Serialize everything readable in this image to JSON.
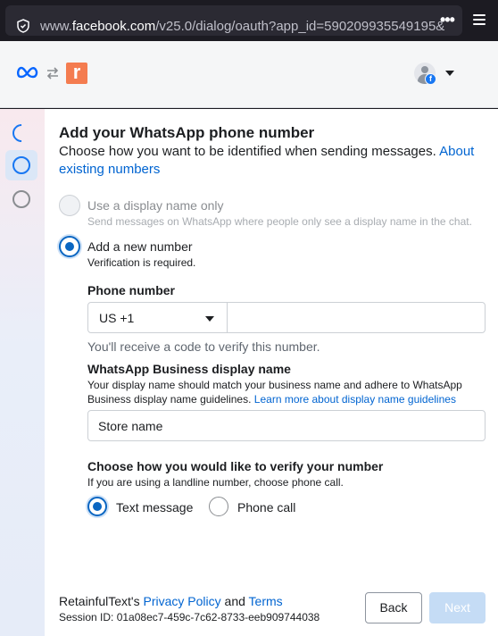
{
  "browser": {
    "url_prefix": "www.",
    "url_domain": "facebook.com",
    "url_path": "/v25.0/dialog/oauth?app_id=590209935549195&"
  },
  "header": {
    "app_logo_letter": "r",
    "app_logo_color": "#f47c50",
    "fb_badge": "f"
  },
  "main": {
    "title": "Add your WhatsApp phone number",
    "subtitle": "Choose how you want to be identified when sending messages.",
    "subtitle_link": "About existing numbers",
    "options": [
      {
        "label": "Use a display name only",
        "sublabel": "Send messages on WhatsApp where people only see a display name in the chat.",
        "selected": false,
        "disabled": true
      },
      {
        "label": "Add a new number",
        "sublabel": "Verification is required.",
        "selected": true,
        "disabled": false
      }
    ],
    "phone": {
      "label": "Phone number",
      "country": "US +1",
      "value": "",
      "hint": "You'll receive a code to verify this number."
    },
    "display_name": {
      "label": "WhatsApp Business display name",
      "description": "Your display name should match your business name and adhere to WhatsApp Business display name guidelines.",
      "description_link": "Learn more about display name guidelines",
      "value": "Store name"
    },
    "verify": {
      "label": "Choose how you would like to verify your number",
      "description": "If you are using a landline number, choose phone call.",
      "options": [
        {
          "label": "Text message",
          "selected": true
        },
        {
          "label": "Phone call",
          "selected": false
        }
      ]
    }
  },
  "footer": {
    "app_name": "RetainfulText's",
    "privacy": "Privacy Policy",
    "and": "and",
    "terms": "Terms",
    "session": "Session ID: 01a08ec7-459c-7c62-8733-eeb909744038",
    "back_label": "Back",
    "next_label": "Next"
  },
  "colors": {
    "accent": "#0a66c2",
    "link": "#0064d1",
    "next_disabled": "#c5dcf5"
  }
}
